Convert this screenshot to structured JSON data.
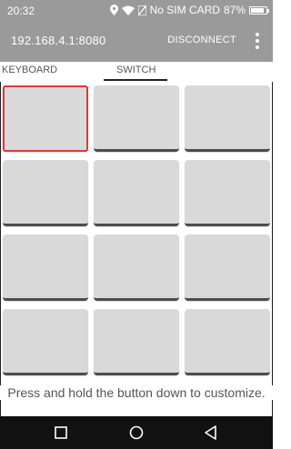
{
  "status_bar": {
    "time": "20:32",
    "carrier": "No SIM CARD",
    "battery": "87%",
    "battery_level": 0.87
  },
  "app_bar": {
    "title": "192.168.4.1:8080",
    "disconnect_label": "DISCONNECT",
    "more_icon": "more-vert-icon"
  },
  "tabs": [
    {
      "label": "KEYBOARD",
      "active": false
    },
    {
      "label": "SWITCH",
      "active": true
    }
  ],
  "grid": {
    "rows": 4,
    "columns": 3,
    "selected_index": 0
  },
  "help_text": "Press and hold the button down to customize.",
  "colors": {
    "app_bar": "#9a9a9a",
    "button_face": "#d9d9d9",
    "selected_border": "#d43c3c",
    "nav_bar": "#111111"
  },
  "nav_bar": {
    "icons": [
      "recents-icon",
      "home-icon",
      "back-icon"
    ]
  }
}
